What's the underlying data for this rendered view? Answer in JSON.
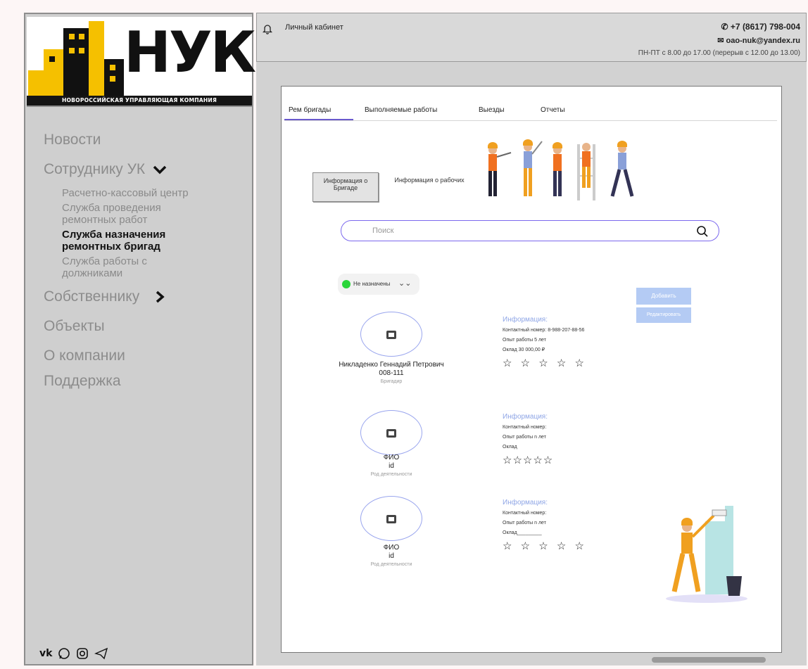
{
  "logo": {
    "brand": "НУК",
    "tagline": "НОВОРОССИЙСКАЯ УПРАВЛЯЮЩАЯ КОМПАНИЯ"
  },
  "sidebar": {
    "items": [
      {
        "label": "Новости"
      },
      {
        "label": "Сотруднику УК"
      },
      {
        "label": "Собственнику"
      },
      {
        "label": "Объекты"
      },
      {
        "label": "О компании"
      },
      {
        "label": "Поддержка"
      }
    ],
    "subitems": [
      {
        "label": "Расчетно-кассовый центр"
      },
      {
        "label": "Служба проведения ремонтных работ"
      },
      {
        "label": "Служба назначения ремонтных бригад"
      },
      {
        "label": "Служба работы с должниками"
      }
    ],
    "socials": [
      "vk-icon",
      "whatsapp-icon",
      "instagram-icon",
      "telegram-icon"
    ]
  },
  "header": {
    "cabinet": "Личный кабинет",
    "phone": "+7 (8617) 798-004",
    "email": "oao-nuk@yandex.ru",
    "hours": "ПН-ПТ с 8.00 до 17.00 (перерыв с 12.00 до 13.00)"
  },
  "tabs": [
    {
      "label": "Рем бригады",
      "active": true
    },
    {
      "label": "Выполняемые работы"
    },
    {
      "label": "Выезды"
    },
    {
      "label": "Отчеты"
    }
  ],
  "info_toggle": {
    "brigade": "Информация о Бригаде",
    "workers": "Информация о рабочих"
  },
  "search": {
    "placeholder": "Поиск"
  },
  "filter": {
    "label": "Не назначены"
  },
  "buttons": {
    "add": "Добавить",
    "edit": "Редактировать"
  },
  "people": [
    {
      "name": "Никладенко Геннадий Петрович",
      "id": "008-111",
      "role": "Бригадир",
      "info_title": "Информация:",
      "contact": "Контактный номер: 8-988-207-88-56",
      "experience": "Опыт работы 5 лет",
      "salary": "Оклад 30 000,00 ₽",
      "rating": "☆ ☆ ☆ ☆ ☆"
    },
    {
      "name": "ФИО",
      "id": "id",
      "role": "Род деятельности",
      "info_title": "Информация:",
      "contact": "Контактный номер:",
      "experience": "Опыт работы n лет",
      "salary": "Оклад",
      "rating": "☆☆☆☆☆"
    },
    {
      "name": "ФИО",
      "id": "id",
      "role": "Род деятельности",
      "info_title": "Информация:",
      "contact": "Контактный номер:",
      "experience": "Опыт работы n лет",
      "salary": "Оклад_________",
      "rating": "☆ ☆ ☆ ☆ ☆"
    }
  ],
  "colors": {
    "accent": "#6a5acd",
    "button": "#b4cbf4",
    "status_green": "#2bd63a",
    "logo_yellow": "#f5c000"
  }
}
